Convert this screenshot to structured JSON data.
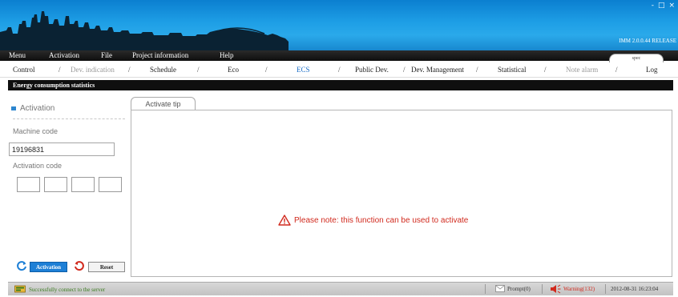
{
  "window": {
    "version": "IMM 2.0.0.44 RELEASE",
    "controls": [
      "-",
      "□",
      "×"
    ]
  },
  "menubar": {
    "items": [
      "Menu",
      "Activation",
      "File",
      "Project information",
      "Help"
    ],
    "spec_tab": "spec"
  },
  "nav": {
    "items": [
      {
        "label": "Control",
        "state": "normal"
      },
      {
        "label": "Dev. indication",
        "state": "muted"
      },
      {
        "label": "Schedule",
        "state": "normal"
      },
      {
        "label": "Eco",
        "state": "normal"
      },
      {
        "label": "ECS",
        "state": "active"
      },
      {
        "label": "Public Dev.",
        "state": "normal"
      },
      {
        "label": "Dev. Management",
        "state": "normal"
      },
      {
        "label": "Statistical",
        "state": "normal"
      },
      {
        "label": "Note alarm",
        "state": "muted"
      },
      {
        "label": "Log",
        "state": "normal"
      }
    ],
    "separator": "/"
  },
  "section": {
    "title": "Energy consumption statistics"
  },
  "left_panel": {
    "title": "Activation",
    "machine_code_label": "Machine code",
    "machine_code_value": "19196831",
    "activation_code_label": "Activation code",
    "activation_code_values": [
      "",
      "",
      "",
      ""
    ],
    "activation_button": "Activation",
    "reset_button": "Reset"
  },
  "main_panel": {
    "tab_label": "Activate tip",
    "note": "Please note: this function can be used to activate"
  },
  "statusbar": {
    "connection": "Successfully connect to the server",
    "prompt": "Prompt(0)",
    "warning": "Warning(132)",
    "datetime": "2012-08-31 16:23:04"
  },
  "colors": {
    "banner": "#1e9fe6",
    "accent": "#1d7fd6",
    "warning": "#d12a1e",
    "success": "#3a7b1e"
  }
}
